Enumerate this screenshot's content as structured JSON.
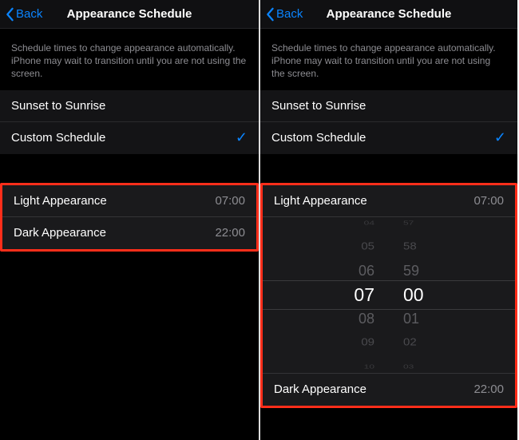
{
  "nav": {
    "back": "Back",
    "title": "Appearance Schedule"
  },
  "description": "Schedule times to change appearance automatically. iPhone may wait to transition until you are not using the screen.",
  "options": {
    "sunset": "Sunset to Sunrise",
    "custom": "Custom Schedule"
  },
  "times": {
    "light_label": "Light Appearance",
    "light_value": "07:00",
    "dark_label": "Dark Appearance",
    "dark_value": "22:00"
  },
  "picker": {
    "hours": [
      "04",
      "05",
      "06",
      "07",
      "08",
      "09",
      "10"
    ],
    "minutes": [
      "57",
      "58",
      "59",
      "00",
      "01",
      "02",
      "03"
    ]
  }
}
